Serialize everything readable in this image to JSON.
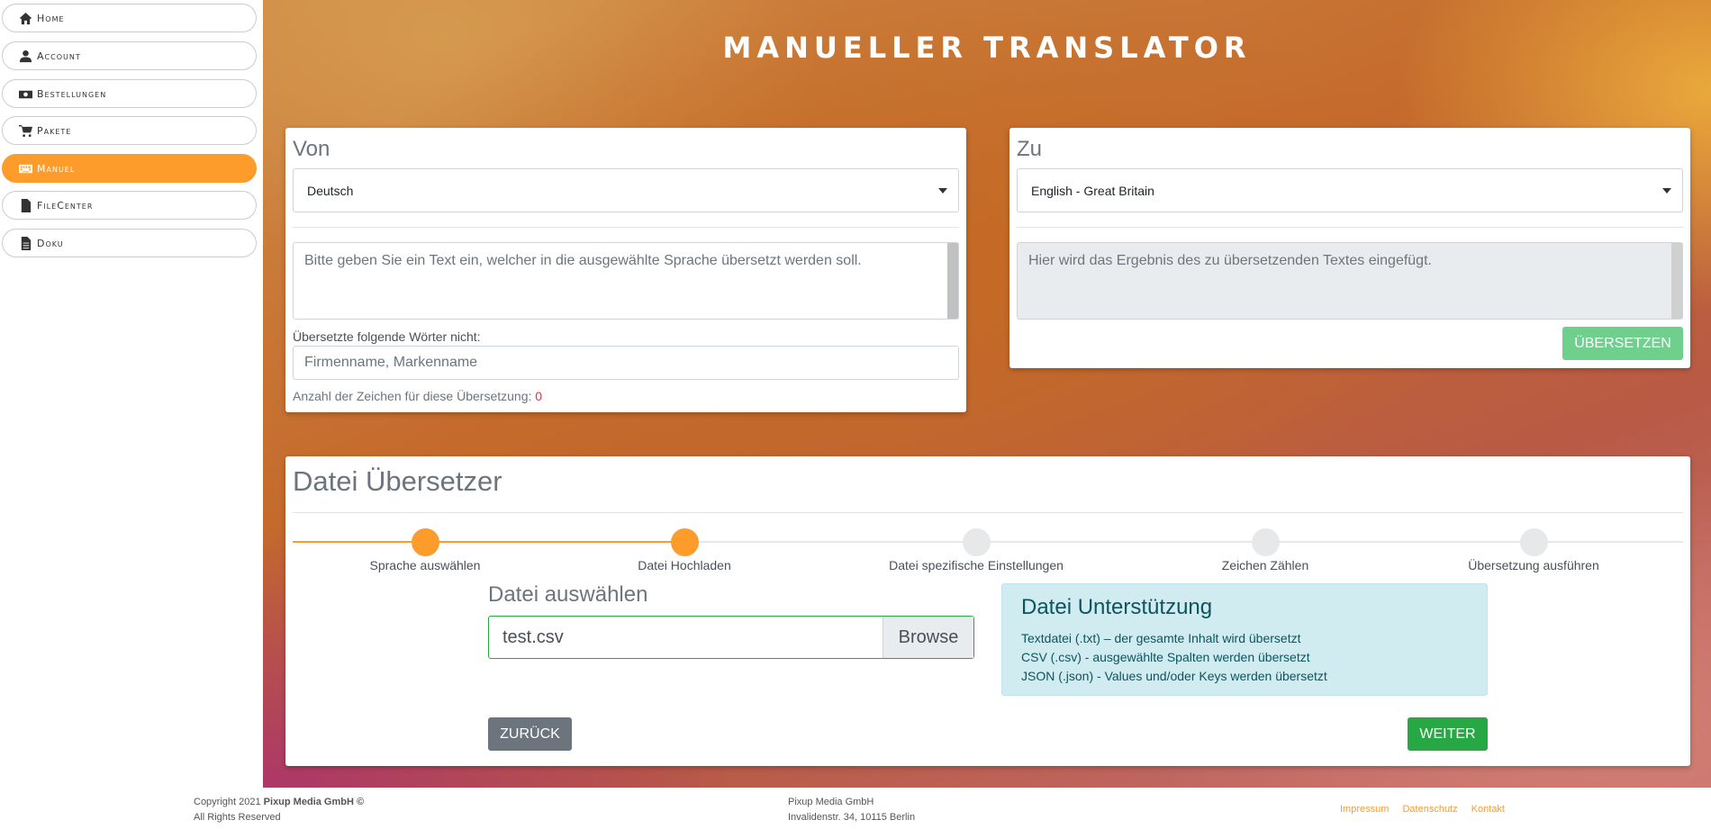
{
  "sidebar": {
    "items": [
      {
        "label": "Home",
        "icon": "home-icon"
      },
      {
        "label": "Account",
        "icon": "user-icon"
      },
      {
        "label": "Bestellungen",
        "icon": "money-icon"
      },
      {
        "label": "Pakete",
        "icon": "cart-icon"
      },
      {
        "label": "Manuel",
        "icon": "keyboard-icon",
        "active": true
      },
      {
        "label": "FileCenter",
        "icon": "file-icon"
      },
      {
        "label": "Doku",
        "icon": "document-icon"
      }
    ]
  },
  "header": {
    "title": "MANUELLER TRANSLATOR"
  },
  "from_card": {
    "title": "Von",
    "language": "Deutsch",
    "text_placeholder": "Bitte geben Sie ein Text ein, welcher in die ausgewählte Sprache übersetzt werden soll.",
    "exclude_label": "Übersetzte folgende Wörter nicht:",
    "exclude_placeholder": "Firmenname, Markenname",
    "char_count_label": "Anzahl der Zeichen für diese Übersetzung:",
    "char_count_value": "0"
  },
  "to_card": {
    "title": "Zu",
    "language": "English - Great Britain",
    "result_placeholder": "Hier wird das Ergebnis des zu übersetzenden Textes eingefügt.",
    "translate_button": "ÜBERSETZEN"
  },
  "file_translator": {
    "title": "Datei Übersetzer",
    "steps": [
      {
        "label": "Sprache auswählen",
        "done": true
      },
      {
        "label": "Datei Hochladen",
        "done": true
      },
      {
        "label": "Datei spezifische Einstellungen",
        "done": false
      },
      {
        "label": "Zeichen Zählen",
        "done": false
      },
      {
        "label": "Übersetzung ausführen",
        "done": false
      }
    ],
    "select_file_label": "Datei auswählen",
    "file_value": "test.csv",
    "browse_label": "Browse",
    "support": {
      "title": "Datei Unterstützung",
      "lines": [
        "Textdatei (.txt) – der gesamte Inhalt wird übersetzt",
        "CSV (.csv) - ausgewählte Spalten werden übersetzt",
        "JSON (.json) - Values und/oder Keys werden übersetzt"
      ]
    },
    "back_button": "ZURÜCK",
    "next_button": "WEITER"
  },
  "footer": {
    "copyright_prefix": "Copyright 2021",
    "company_bold": "Pixup Media GmbH ©",
    "rights": "All Rights Reserved",
    "address_company": "Pixup Media GmbH",
    "address_street": "Invalidenstr. 34, 10115 Berlin",
    "links": [
      "Impressum",
      "Datenschutz",
      "Kontakt"
    ]
  },
  "colors": {
    "accent": "#fd9b2b",
    "success": "#28a745",
    "info_bg": "#d1ecf1",
    "secondary": "#6c757d"
  }
}
